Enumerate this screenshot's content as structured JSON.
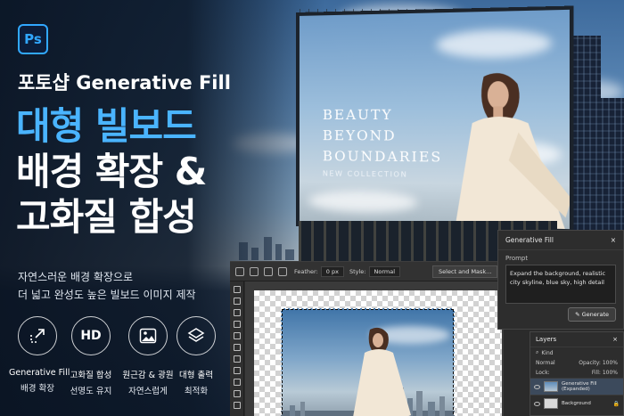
{
  "brand": {
    "logo_text": "Ps"
  },
  "headline": "포토샵 Generative Fill",
  "title_lines": [
    "대형 빌보드",
    "배경 확장 &",
    "고화질 합성"
  ],
  "description": [
    "자연스러운 배경 확장으로",
    "더 넓고 완성도 높은 빌보드 이미지 제작"
  ],
  "features": [
    {
      "icon": "expand-arrow-icon",
      "label1": "Generative Fill",
      "label2": "배경 확장"
    },
    {
      "icon": "hd-icon",
      "icon_text": "HD",
      "label1": "고화질 합성",
      "label2": "선명도 유지"
    },
    {
      "icon": "image-icon",
      "label1": "원근감 & 광원",
      "label2": "자연스럽게"
    },
    {
      "icon": "layers-icon",
      "label1": "대형 출력",
      "label2": "최적화"
    }
  ],
  "billboard": {
    "lines": [
      "BEAUTY",
      "BEYOND",
      "BOUNDARIES"
    ],
    "sub": "NEW COLLECTION"
  },
  "options_bar": {
    "feather_label": "Feather:",
    "feather_value": "0 px",
    "style_label": "Style:",
    "style_value": "Normal",
    "select_mask": "Select and Mask..."
  },
  "generative_fill": {
    "title": "Generative Fill",
    "close": "×",
    "prompt_label": "Prompt",
    "prompt_text": "Expand the background, realistic city skyline, blue sky, high detail",
    "button": "Generate"
  },
  "layers": {
    "title": "Layers",
    "close": "×",
    "kind": "Kind",
    "blend": "Normal",
    "opacity_label": "Opacity:",
    "opacity_value": "100%",
    "lock_label": "Lock:",
    "fill_label": "Fill:",
    "fill_value": "100%",
    "items": [
      {
        "name": "Generative Fill",
        "sub": "(Expanded)"
      },
      {
        "name": "Background"
      }
    ]
  },
  "colors": {
    "accent_blue": "#4ab4ff",
    "ps_blue": "#31a8ff",
    "bg_dark": "#0e1a2c"
  }
}
